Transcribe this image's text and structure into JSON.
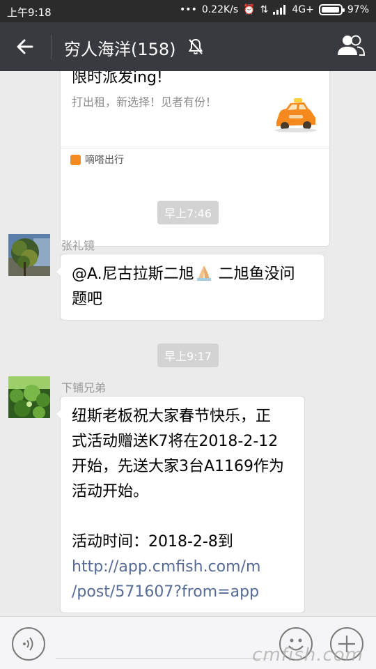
{
  "status_bar": {
    "time": "上午9:18",
    "dots": "•••",
    "net_speed": "0.22K/s",
    "network": "4G+",
    "battery": "97%",
    "battery_level": 0.97
  },
  "header": {
    "title": "穷人海洋(158)",
    "muted": true
  },
  "messages": {
    "card": {
      "title": "限时派发ing!",
      "description": "打出租，新选择！见者有份！",
      "source": "嘀嗒出行"
    },
    "time1": "早上7:46",
    "msg1": {
      "sender": "张礼镜",
      "line1_a": "@A.尼古拉斯二旭",
      "line1_b": "二旭鱼没问",
      "line2": "题吧"
    },
    "time2": "早上9:17",
    "msg2": {
      "sender": "下铺兄弟",
      "lines": [
        "纽斯老板祝大家春节快乐，正",
        "式活动赠送K7将在2018-2-12",
        "开始，先送大家3台A1169作为",
        "活动开始。",
        "活动时间：2018-2-8到"
      ],
      "link_lines": [
        "http://app.cmfish.com/m",
        "/post/571607?from=app"
      ]
    }
  },
  "input_bar": {
    "watermark": "cmfish.com"
  },
  "colors": {
    "titlebar": "#393a3f",
    "statusbar": "#2b2b2b",
    "chat_bg": "#ebebeb",
    "link": "#576b95"
  }
}
